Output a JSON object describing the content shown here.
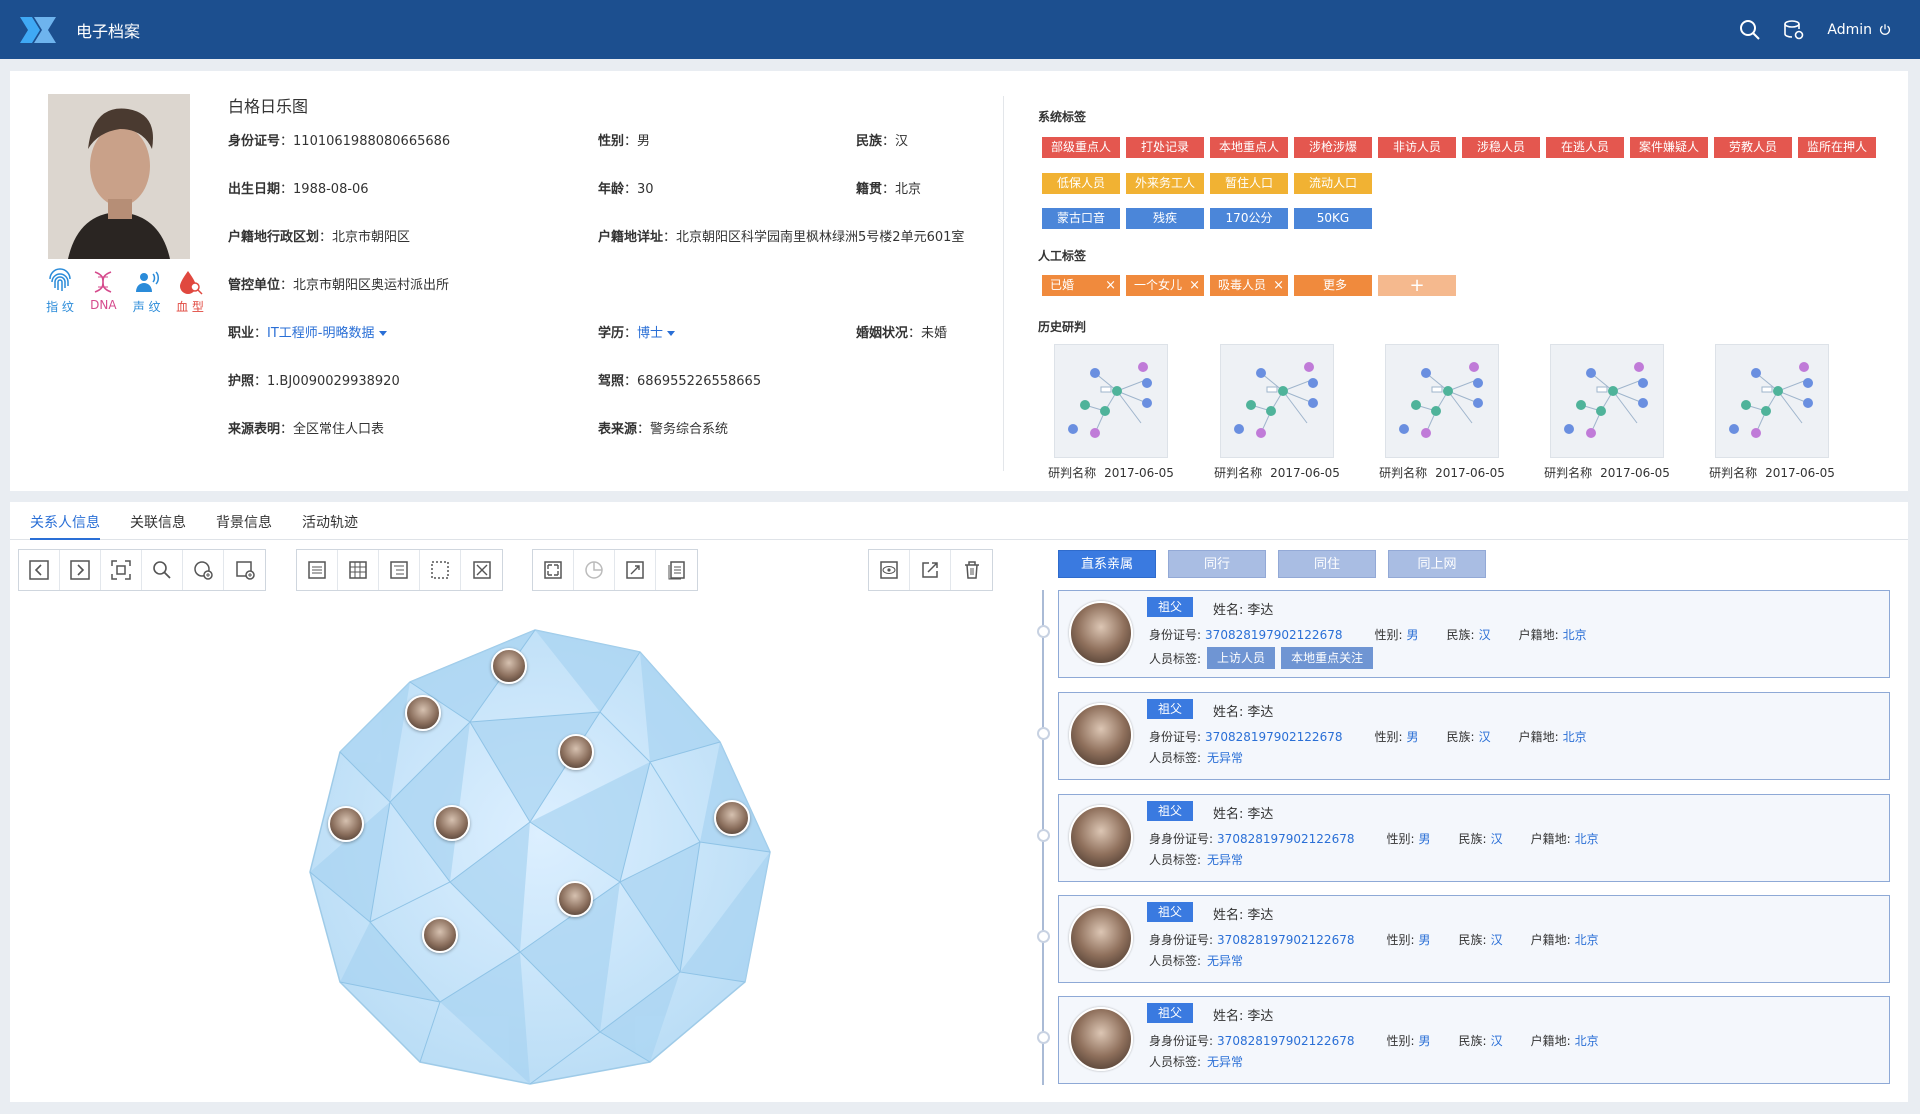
{
  "header": {
    "title": "电子档案",
    "user": "Admin"
  },
  "profile": {
    "name": "白格日乐图",
    "fields": {
      "id_label": "身份证号",
      "id": "1101061988080665686",
      "gender_label": "性别",
      "gender": "男",
      "ethnic_label": "民族",
      "ethnic": "汉",
      "birth_label": "出生日期",
      "birth": "1988-08-06",
      "age_label": "年龄",
      "age": "30",
      "origin_label": "籍贯",
      "origin": "北京",
      "hukou_region_label": "户籍地行政区划",
      "hukou_region": "北京市朝阳区",
      "hukou_addr_label": "户籍地详址",
      "hukou_addr": "北京朝阳区科学园南里枫林绿洲5号楼2单元601室",
      "control_label": "管控单位",
      "control": "北京市朝阳区奥运村派出所",
      "job_label": "职业",
      "job": "IT工程师-明略数据",
      "edu_label": "学历",
      "edu": "博士",
      "marital_label": "婚姻状况",
      "marital": "未婚",
      "passport_label": "护照",
      "passport": "1.BJ0090029938920",
      "license_label": "驾照",
      "license": "686955226558665",
      "source_label": "来源表明",
      "source": "全区常住人口表",
      "table_source_label": "表来源",
      "table_source": "警务综合系统"
    },
    "bio": [
      "指 纹",
      "DNA",
      "声 纹",
      "血 型"
    ]
  },
  "tags": {
    "system_title": "系统标签",
    "system_red": [
      "部级重点人",
      "打处记录",
      "本地重点人",
      "涉枪涉爆",
      "非访人员",
      "涉稳人员",
      "在逃人员",
      "案件嫌疑人",
      "劳教人员",
      "监所在押人员"
    ],
    "system_yellow": [
      "低保人员",
      "外来务工人员",
      "暂住人口",
      "流动人口"
    ],
    "system_blue": [
      "蒙古口音",
      "残疾",
      "170公分",
      "50KG"
    ],
    "manual_title": "人工标签",
    "manual": [
      "已婚",
      "一个女儿",
      "吸毒人员",
      "更多"
    ],
    "plus": "+",
    "history_title": "历史研判",
    "history": [
      {
        "name": "研判名称",
        "date": "2017-06-05"
      },
      {
        "name": "研判名称",
        "date": "2017-06-05"
      },
      {
        "name": "研判名称",
        "date": "2017-06-05"
      },
      {
        "name": "研判名称",
        "date": "2017-06-05"
      },
      {
        "name": "研判名称",
        "date": "2017-06-05"
      }
    ]
  },
  "tabs": [
    "关系人信息",
    "关联信息",
    "背景信息",
    "活动轨迹"
  ],
  "filters": [
    "直系亲属",
    "同行",
    "同住",
    "同上网"
  ],
  "relations": [
    {
      "badge": "祖父",
      "name_label": "姓名:",
      "name": "李达",
      "id_label": "身份证号:",
      "id": "370828197902122678",
      "gender_label": "性别:",
      "gender": "男",
      "ethnic_label": "民族:",
      "ethnic": "汉",
      "hukou_label": "户籍地:",
      "hukou": "北京",
      "tags_label": "人员标签:",
      "tags": [
        "上访人员",
        "本地重点关注"
      ]
    },
    {
      "badge": "祖父",
      "name_label": "姓名:",
      "name": "李达",
      "id_label": "身份证号:",
      "id": "370828197902122678",
      "gender_label": "性别:",
      "gender": "男",
      "ethnic_label": "民族:",
      "ethnic": "汉",
      "hukou_label": "户籍地:",
      "hukou": "北京",
      "tags_label": "人员标签:",
      "tag_text": "无异常"
    },
    {
      "badge": "祖父",
      "name_label": "姓名:",
      "name": "李达",
      "id_label": "身身份证号:",
      "id": "370828197902122678",
      "gender_label": "性别:",
      "gender": "男",
      "ethnic_label": "民族:",
      "ethnic": "汉",
      "hukou_label": "户籍地:",
      "hukou": "北京",
      "tags_label": "人员标签:",
      "tag_text": "无异常"
    },
    {
      "badge": "祖父",
      "name_label": "姓名:",
      "name": "李达",
      "id_label": "身身份证号:",
      "id": "370828197902122678",
      "gender_label": "性别:",
      "gender": "男",
      "ethnic_label": "民族:",
      "ethnic": "汉",
      "hukou_label": "户籍地:",
      "hukou": "北京",
      "tags_label": "人员标签:",
      "tag_text": "无异常"
    },
    {
      "badge": "祖父",
      "name_label": "姓名:",
      "name": "李达",
      "id_label": "身身份证号:",
      "id": "370828197902122678",
      "gender_label": "性别:",
      "gender": "男",
      "ethnic_label": "民族:",
      "ethnic": "汉",
      "hukou_label": "户籍地:",
      "hukou": "北京",
      "tags_label": "人员标签:",
      "tag_text": "无异常"
    }
  ],
  "icons": {
    "toolbar1": [
      "prev-icon",
      "next-icon",
      "select-frame-icon",
      "search-icon",
      "add-node-icon",
      "expand-node-icon"
    ],
    "toolbar2": [
      "list-layout-icon",
      "grid-layout-icon",
      "tree-layout-icon",
      "dotted-frame-icon",
      "fit-screen-icon"
    ],
    "toolbar3": [
      "zoom-fit-icon",
      "pie-analysis-icon",
      "export-image-icon",
      "report-icon"
    ],
    "toolbar4": [
      "eye-toggle-icon",
      "share-out-icon",
      "delete-icon"
    ]
  },
  "colors": {
    "header_bg": "#1c4f8f",
    "accent": "#3a7ae0",
    "tag_red": "#e4574f",
    "tag_yellow": "#f1b233",
    "tag_blue": "#4b86d9",
    "tag_orange": "#f08a3d"
  }
}
